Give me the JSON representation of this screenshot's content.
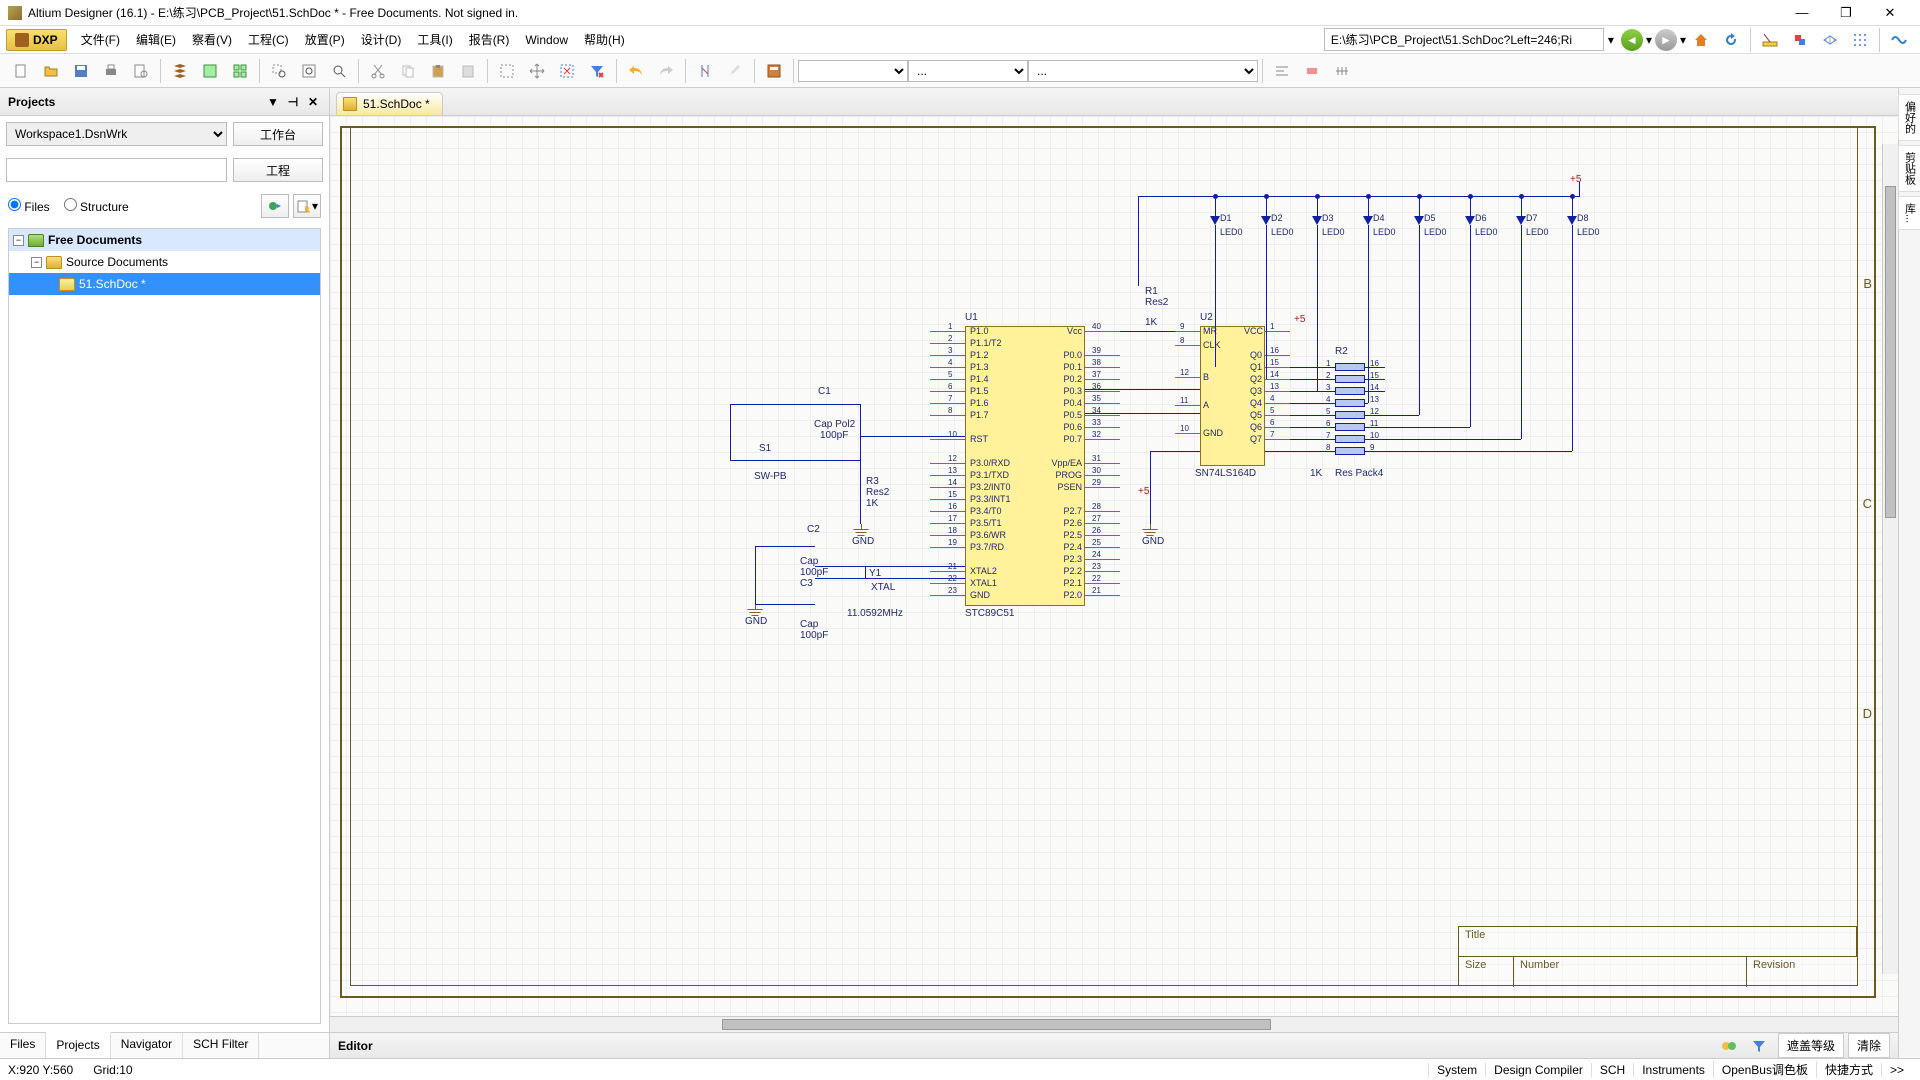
{
  "title": "Altium Designer (16.1) - E:\\练习\\PCB_Project\\51.SchDoc * - Free Documents. Not signed in.",
  "menu": {
    "dxp": "DXP",
    "file": "文件(F)",
    "edit": "编辑(E)",
    "view": "察看(V)",
    "project": "工程(C)",
    "place": "放置(P)",
    "design": "设计(D)",
    "tools": "工具(I)",
    "report": "报告(R)",
    "window": "Window",
    "help": "帮助(H)"
  },
  "path_display": "E:\\练习\\PCB_Project\\51.SchDoc?Left=246;Ri",
  "projects_panel": {
    "title": "Projects",
    "workspace": "Workspace1.DsnWrk",
    "btn_workspace": "工作台",
    "btn_project": "工程",
    "radio_files": "Files",
    "radio_structure": "Structure",
    "tree_root": "Free Documents",
    "tree_src": "Source Documents",
    "tree_doc": "51.SchDoc *"
  },
  "left_tabs": {
    "files": "Files",
    "projects": "Projects",
    "navigator": "Navigator",
    "sch_filter": "SCH Filter"
  },
  "doc_tab": "51.SchDoc *",
  "editor_label": "Editor",
  "bottom": {
    "mask": "遮盖等级",
    "clear": "清除"
  },
  "status": {
    "coord": "X:920 Y:560",
    "grid": "Grid:10",
    "system": "System",
    "compiler": "Design Compiler",
    "sch": "SCH",
    "instr": "Instruments",
    "openbus": "OpenBus调色板",
    "shortcut": "快捷方式",
    "more": ">>"
  },
  "right_tabs": {
    "fav": "偏好的",
    "clip": "剪贴板",
    "lib": "库..."
  },
  "schem": {
    "u1": {
      "ref": "U1",
      "name": "STC89C51",
      "left": [
        "P1.0",
        "P1.1/T2",
        "P1.2",
        "P1.3",
        "P1.4",
        "P1.5",
        "P1.6",
        "P1.7",
        "",
        "RST",
        "",
        "P3.0/RXD",
        "P3.1/TXD",
        "P3.2/INT0",
        "P3.3/INT1",
        "P3.4/T0",
        "P3.5/T1",
        "P3.6/WR",
        "P3.7/RD",
        "",
        "XTAL2",
        "XTAL1",
        "GND"
      ],
      "right": [
        "Vcc",
        "",
        "P0.0",
        "P0.1",
        "P0.2",
        "P0.3",
        "P0.4",
        "P0.5",
        "P0.6",
        "P0.7",
        "",
        "Vpp/EA",
        "PROG",
        "PSEN",
        "",
        "P2.7",
        "P2.6",
        "P2.5",
        "P2.4",
        "P2.3",
        "P2.2",
        "P2.1",
        "P2.0"
      ]
    },
    "u2": {
      "ref": "U2",
      "name": "SN74LS164D",
      "left": [
        "MR",
        "CLK",
        "",
        "B",
        "",
        "A",
        "",
        "GND"
      ],
      "right": [
        "VCC",
        "",
        "Q0",
        "Q1",
        "Q2",
        "Q3",
        "Q4",
        "Q5",
        "Q6",
        "Q7"
      ]
    },
    "r2": {
      "ref": "R2",
      "name": "Res Pack4",
      "val": "1K"
    },
    "c1": {
      "ref": "C1",
      "name": "Cap Pol2",
      "val": "100pF"
    },
    "c2": {
      "ref": "C2",
      "name": "Cap",
      "val": "100pF"
    },
    "c3": {
      "ref": "C3",
      "name": "Cap",
      "val": "100pF"
    },
    "r1": {
      "ref": "R1",
      "name": "Res2",
      "val": "1K"
    },
    "r3": {
      "ref": "R3",
      "name": "Res2",
      "val": "1K"
    },
    "s1": {
      "ref": "S1",
      "name": "SW-PB"
    },
    "y1": {
      "ref": "Y1",
      "name": "XTAL",
      "val": "11.0592MHz"
    },
    "leds": [
      "D1",
      "D2",
      "D3",
      "D4",
      "D5",
      "D6",
      "D7",
      "D8"
    ],
    "led_name": "LED0",
    "gnd": "GND",
    "pwr": "+5",
    "tb": {
      "title": "Title",
      "size": "Size",
      "number": "Number",
      "rev": "Revision"
    },
    "zones": [
      "B",
      "C",
      "D"
    ]
  }
}
